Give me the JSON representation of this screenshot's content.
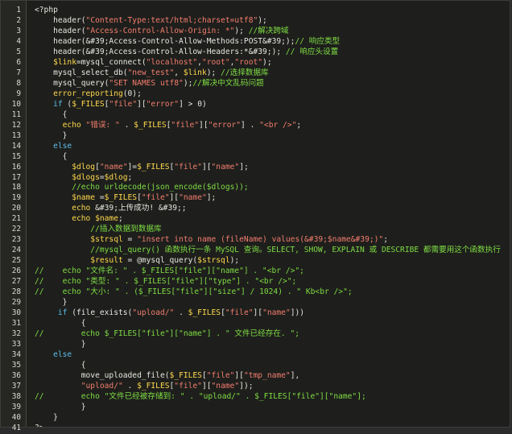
{
  "colors": {
    "background": "#1e1f1c",
    "gutter": "#262723",
    "default_text": "#e6e6e0",
    "string": "#f37c6e",
    "keyword": "#5cbde8",
    "variable": "#ffd84d",
    "comment": "#7fdc44"
  },
  "editor": {
    "lines": [
      {
        "n": "1",
        "tokens": [
          {
            "t": "d",
            "v": "<?php"
          }
        ]
      },
      {
        "n": "2",
        "tokens": [
          {
            "t": "d",
            "v": "    header("
          },
          {
            "t": "s",
            "v": "\"Content-Type:text/html;charset=utf8\""
          },
          {
            "t": "d",
            "v": ");"
          }
        ]
      },
      {
        "n": "3",
        "tokens": [
          {
            "t": "d",
            "v": "    header("
          },
          {
            "t": "s",
            "v": "\"Access-Control-Allow-Origin: *\""
          },
          {
            "t": "d",
            "v": "); "
          },
          {
            "t": "c",
            "v": "//解决跨域"
          }
        ]
      },
      {
        "n": "4",
        "tokens": [
          {
            "t": "d",
            "v": "    header(&#39;Access-Control-Allow-Methods:POST&#39;);"
          },
          {
            "t": "c",
            "v": "// 响应类型"
          }
        ]
      },
      {
        "n": "5",
        "tokens": [
          {
            "t": "d",
            "v": "    header(&#39;Access-Control-Allow-Headers:*&#39;); "
          },
          {
            "t": "c",
            "v": "// 响应头设置"
          }
        ]
      },
      {
        "n": "6",
        "tokens": [
          {
            "t": "v",
            "v": "    $link"
          },
          {
            "t": "d",
            "v": "=mysql_connect("
          },
          {
            "t": "s",
            "v": "\"localhost\""
          },
          {
            "t": "d",
            "v": ","
          },
          {
            "t": "s",
            "v": "\"root\""
          },
          {
            "t": "d",
            "v": ","
          },
          {
            "t": "s",
            "v": "\"root\""
          },
          {
            "t": "d",
            "v": ");"
          }
        ]
      },
      {
        "n": "7",
        "tokens": [
          {
            "t": "d",
            "v": "    mysql_select_db("
          },
          {
            "t": "s",
            "v": "\"new_test\""
          },
          {
            "t": "d",
            "v": ", "
          },
          {
            "t": "v",
            "v": "$link"
          },
          {
            "t": "d",
            "v": "); "
          },
          {
            "t": "c",
            "v": "//选择数据库"
          }
        ]
      },
      {
        "n": "8",
        "tokens": [
          {
            "t": "d",
            "v": "    mysql_query("
          },
          {
            "t": "s",
            "v": "\"SET NAMES utf8\""
          },
          {
            "t": "d",
            "v": ");"
          },
          {
            "t": "c",
            "v": "//解决中文乱码问题"
          }
        ]
      },
      {
        "n": "9",
        "tokens": [
          {
            "t": "v",
            "v": "    error_reporting"
          },
          {
            "t": "d",
            "v": "(0);"
          }
        ]
      },
      {
        "n": "10",
        "tokens": [
          {
            "t": "k",
            "v": "    if"
          },
          {
            "t": "d",
            "v": " ("
          },
          {
            "t": "v",
            "v": "$_FILES"
          },
          {
            "t": "d",
            "v": "["
          },
          {
            "t": "s",
            "v": "\"file\""
          },
          {
            "t": "d",
            "v": "]["
          },
          {
            "t": "s",
            "v": "\"error\""
          },
          {
            "t": "d",
            "v": "] > 0)"
          }
        ]
      },
      {
        "n": "11",
        "tokens": [
          {
            "t": "d",
            "v": "      {"
          }
        ]
      },
      {
        "n": "12",
        "tokens": [
          {
            "t": "v",
            "v": "      echo"
          },
          {
            "t": "d",
            "v": " "
          },
          {
            "t": "s",
            "v": "\"错误: \""
          },
          {
            "t": "d",
            "v": " . "
          },
          {
            "t": "v",
            "v": "$_FILES"
          },
          {
            "t": "d",
            "v": "["
          },
          {
            "t": "s",
            "v": "\"file\""
          },
          {
            "t": "d",
            "v": "]["
          },
          {
            "t": "s",
            "v": "\"error\""
          },
          {
            "t": "d",
            "v": "] . "
          },
          {
            "t": "s",
            "v": "\"<br />\""
          },
          {
            "t": "d",
            "v": ";"
          }
        ]
      },
      {
        "n": "13",
        "tokens": [
          {
            "t": "d",
            "v": "      }"
          }
        ]
      },
      {
        "n": "14",
        "tokens": [
          {
            "t": "k",
            "v": "    else"
          }
        ]
      },
      {
        "n": "15",
        "tokens": [
          {
            "t": "d",
            "v": "      {"
          }
        ]
      },
      {
        "n": "16",
        "tokens": [
          {
            "t": "v",
            "v": "        $dlog"
          },
          {
            "t": "d",
            "v": "["
          },
          {
            "t": "s",
            "v": "\"name\""
          },
          {
            "t": "d",
            "v": "]="
          },
          {
            "t": "v",
            "v": "$_FILES"
          },
          {
            "t": "d",
            "v": "["
          },
          {
            "t": "s",
            "v": "\"file\""
          },
          {
            "t": "d",
            "v": "]["
          },
          {
            "t": "s",
            "v": "\"name\""
          },
          {
            "t": "d",
            "v": "];"
          }
        ]
      },
      {
        "n": "17",
        "tokens": [
          {
            "t": "v",
            "v": "        $dlogs"
          },
          {
            "t": "d",
            "v": "="
          },
          {
            "t": "v",
            "v": "$dlog"
          },
          {
            "t": "d",
            "v": ";"
          }
        ]
      },
      {
        "n": "18",
        "tokens": [
          {
            "t": "c",
            "v": "        //echo urldecode(json_encode($dlogs));"
          }
        ]
      },
      {
        "n": "19",
        "tokens": [
          {
            "t": "v",
            "v": "        $name"
          },
          {
            "t": "d",
            "v": " ="
          },
          {
            "t": "v",
            "v": "$_FILES"
          },
          {
            "t": "d",
            "v": "["
          },
          {
            "t": "s",
            "v": "\"file\""
          },
          {
            "t": "d",
            "v": "]["
          },
          {
            "t": "s",
            "v": "\"name\""
          },
          {
            "t": "d",
            "v": "];"
          }
        ]
      },
      {
        "n": "20",
        "tokens": [
          {
            "t": "v",
            "v": "        echo"
          },
          {
            "t": "d",
            "v": " &#39;上传成功! &#39;;"
          }
        ]
      },
      {
        "n": "21",
        "tokens": [
          {
            "t": "v",
            "v": "        echo $name"
          },
          {
            "t": "d",
            "v": ";"
          }
        ]
      },
      {
        "n": "22",
        "tokens": [
          {
            "t": "c",
            "v": "            //插入数据到数据库"
          }
        ]
      },
      {
        "n": "23",
        "tokens": [
          {
            "t": "v",
            "v": "            $strsql"
          },
          {
            "t": "d",
            "v": " = "
          },
          {
            "t": "s",
            "v": "\"insert into name (fileName) values(&#39;$name&#39;)\""
          },
          {
            "t": "d",
            "v": ";"
          }
        ]
      },
      {
        "n": "24",
        "tokens": [
          {
            "t": "c",
            "v": "            //mysql_query() 函数执行一条 MySQL 查询。SELECT, SHOW, EXPLAIN 或 DESCRIBE 都需要用这个函数执行"
          }
        ]
      },
      {
        "n": "25",
        "tokens": [
          {
            "t": "v",
            "v": "            $result"
          },
          {
            "t": "d",
            "v": " = @mysql_query("
          },
          {
            "t": "v",
            "v": "$strsql"
          },
          {
            "t": "d",
            "v": ");"
          }
        ]
      },
      {
        "n": "26",
        "tokens": [
          {
            "t": "c",
            "v": "//    echo \"文件名: \" . $_FILES[\"file\"][\"name\"] . \"<br />\";"
          }
        ]
      },
      {
        "n": "27",
        "tokens": [
          {
            "t": "c",
            "v": "//    echo \"类型: \" . $_FILES[\"file\"][\"type\"] . \"<br />\";"
          }
        ]
      },
      {
        "n": "28",
        "tokens": [
          {
            "t": "c",
            "v": "//    echo \"大小: \" . ($_FILES[\"file\"][\"size\"] / 1024) . \" Kb<br />\";"
          }
        ]
      },
      {
        "n": "29",
        "tokens": [
          {
            "t": "d",
            "v": "      }"
          }
        ]
      },
      {
        "n": "30",
        "tokens": [
          {
            "t": "k",
            "v": "     if"
          },
          {
            "t": "d",
            "v": " (file_exists("
          },
          {
            "t": "s",
            "v": "\"upload/\""
          },
          {
            "t": "d",
            "v": " . "
          },
          {
            "t": "v",
            "v": "$_FILES"
          },
          {
            "t": "d",
            "v": "["
          },
          {
            "t": "s",
            "v": "\"file\""
          },
          {
            "t": "d",
            "v": "]["
          },
          {
            "t": "s",
            "v": "\"name\""
          },
          {
            "t": "d",
            "v": "]))"
          }
        ]
      },
      {
        "n": "31",
        "tokens": [
          {
            "t": "d",
            "v": "          {"
          }
        ]
      },
      {
        "n": "32",
        "tokens": [
          {
            "t": "c",
            "v": "//        echo $_FILES[\"file\"][\"name\"] . \" 文件已经存在. \";"
          }
        ]
      },
      {
        "n": "33",
        "tokens": [
          {
            "t": "d",
            "v": "          }"
          }
        ]
      },
      {
        "n": "34",
        "tokens": [
          {
            "t": "k",
            "v": "    else"
          }
        ]
      },
      {
        "n": "35",
        "tokens": [
          {
            "t": "d",
            "v": "          {"
          }
        ]
      },
      {
        "n": "36",
        "tokens": [
          {
            "t": "d",
            "v": "          move_uploaded_file("
          },
          {
            "t": "v",
            "v": "$_FILES"
          },
          {
            "t": "d",
            "v": "["
          },
          {
            "t": "s",
            "v": "\"file\""
          },
          {
            "t": "d",
            "v": "]["
          },
          {
            "t": "s",
            "v": "\"tmp_name\""
          },
          {
            "t": "d",
            "v": "],"
          }
        ]
      },
      {
        "n": "37",
        "tokens": [
          {
            "t": "s",
            "v": "          \"upload/\""
          },
          {
            "t": "d",
            "v": " . "
          },
          {
            "t": "v",
            "v": "$_FILES"
          },
          {
            "t": "d",
            "v": "["
          },
          {
            "t": "s",
            "v": "\"file\""
          },
          {
            "t": "d",
            "v": "]["
          },
          {
            "t": "s",
            "v": "\"name\""
          },
          {
            "t": "d",
            "v": "]);"
          }
        ]
      },
      {
        "n": "38",
        "tokens": [
          {
            "t": "c",
            "v": "//        echo \"文件已经被存储到: \" . \"upload/\" . $_FILES[\"file\"][\"name\"];"
          }
        ]
      },
      {
        "n": "39",
        "tokens": [
          {
            "t": "d",
            "v": "          }"
          }
        ]
      },
      {
        "n": "40",
        "tokens": [
          {
            "t": "d",
            "v": "    }"
          }
        ]
      },
      {
        "n": "41",
        "tokens": [
          {
            "t": "d",
            "v": "?>"
          }
        ]
      }
    ]
  }
}
